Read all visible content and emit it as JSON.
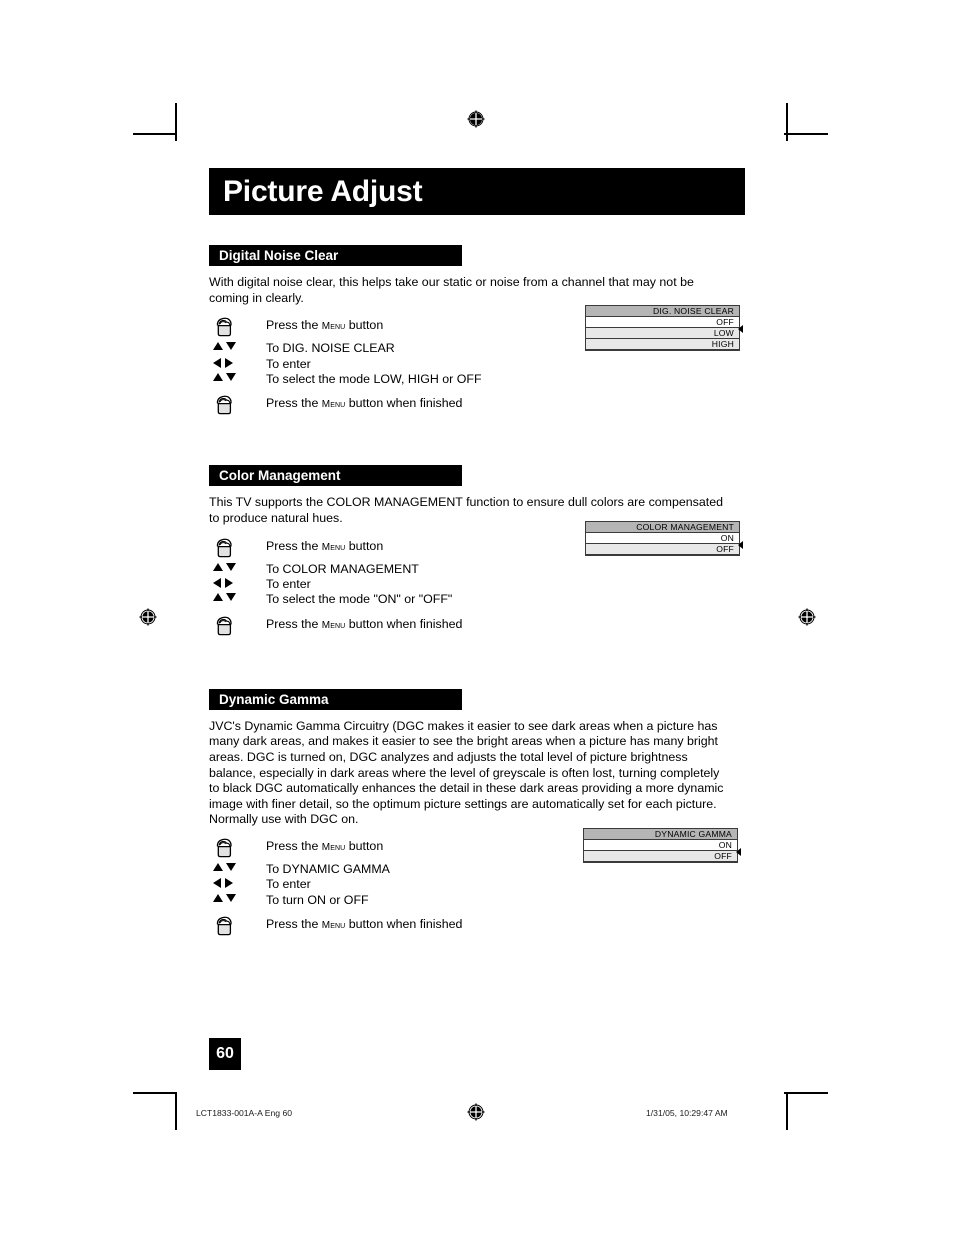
{
  "page": {
    "title": "Picture Adjust",
    "number": "60"
  },
  "sections": [
    {
      "heading": "Digital Noise Clear",
      "body": "With digital noise clear, this helps take our static or noise from a channel that may not be coming in clearly.",
      "steps": [
        {
          "key": "hand",
          "icon": "hand-press-icon",
          "text_pre": "Press the ",
          "text_smallcap": "Menu",
          "text_post": " button"
        },
        {
          "key": "updown",
          "icon": "up-down-arrows-icon",
          "text_pre": "To DIG. NOISE CLEAR",
          "text_smallcap": "",
          "text_post": ""
        },
        {
          "key": "leftright",
          "icon": "left-right-arrows-icon",
          "text_pre": "To enter",
          "text_smallcap": "",
          "text_post": ""
        },
        {
          "key": "updown",
          "icon": "up-down-arrows-icon",
          "text_pre": "To select the mode LOW,  HIGH or OFF",
          "text_smallcap": "",
          "text_post": ""
        },
        {
          "key": "hand",
          "icon": "hand-press-icon",
          "text_pre": "Press the ",
          "text_smallcap": "Menu",
          "text_post": " button when finished"
        }
      ],
      "osd": {
        "header": "DIG. NOISE CLEAR",
        "rows": [
          {
            "label": "OFF",
            "style": "white"
          },
          {
            "label": "LOW",
            "style": "grey"
          },
          {
            "label": "HIGH",
            "style": "grey"
          }
        ],
        "cursor_row": 1
      }
    },
    {
      "heading": "Color Management",
      "body": "This TV supports the COLOR MANAGEMENT function to ensure dull colors are compensated to produce natural hues.",
      "steps": [
        {
          "key": "hand",
          "icon": "hand-press-icon",
          "text_pre": "Press the ",
          "text_smallcap": "Menu",
          "text_post": " button"
        },
        {
          "key": "updown",
          "icon": "up-down-arrows-icon",
          "text_pre": "To COLOR MANAGEMENT",
          "text_smallcap": "",
          "text_post": ""
        },
        {
          "key": "leftright",
          "icon": "left-right-arrows-icon",
          "text_pre": "To enter",
          "text_smallcap": "",
          "text_post": ""
        },
        {
          "key": "updown",
          "icon": "up-down-arrows-icon",
          "text_pre": "To select the mode \"ON\" or \"OFF\"",
          "text_smallcap": "",
          "text_post": ""
        },
        {
          "key": "hand",
          "icon": "hand-press-icon",
          "text_pre": "Press the ",
          "text_smallcap": "Menu",
          "text_post": " button when finished"
        }
      ],
      "osd": {
        "header": "COLOR MANAGEMENT",
        "rows": [
          {
            "label": "ON",
            "style": "white"
          },
          {
            "label": "OFF",
            "style": "grey"
          }
        ],
        "cursor_row": 1
      }
    },
    {
      "heading": "Dynamic Gamma",
      "body": "JVC's Dynamic Gamma Circuitry (DGC makes it easier to see dark areas when a picture has many dark areas, and makes it easier to see the bright areas when a picture has many bright areas.  DGC is turned on, DGC analyzes and adjusts the total level of picture brightness balance, especially in dark areas where the level of greyscale is often lost, turning completely to black DGC automatically enhances the detail in these dark areas providing a more dynamic image with finer detail, so the optimum picture settings are automatically set for each picture. Normally use with DGC on.",
      "steps": [
        {
          "key": "hand",
          "icon": "hand-press-icon",
          "text_pre": "Press the ",
          "text_smallcap": "Menu",
          "text_post": " button"
        },
        {
          "key": "updown",
          "icon": "up-down-arrows-icon",
          "text_pre": "To DYNAMIC GAMMA",
          "text_smallcap": "",
          "text_post": ""
        },
        {
          "key": "leftright",
          "icon": "left-right-arrows-icon",
          "text_pre": "To enter",
          "text_smallcap": "",
          "text_post": ""
        },
        {
          "key": "updown",
          "icon": "up-down-arrows-icon",
          "text_pre": "To turn ON or OFF",
          "text_smallcap": "",
          "text_post": ""
        },
        {
          "key": "hand",
          "icon": "hand-press-icon",
          "text_pre": "Press the ",
          "text_smallcap": "Menu",
          "text_post": " button when finished"
        }
      ],
      "osd": {
        "header": "DYNAMIC GAMMA",
        "rows": [
          {
            "label": "ON",
            "style": "white"
          },
          {
            "label": "OFF",
            "style": "grey"
          }
        ],
        "cursor_row": 1
      }
    }
  ],
  "footer": {
    "left": "LCT1833-001A-A Eng   60",
    "right": "1/31/05, 10:29:47 AM"
  },
  "colors": {
    "bar_background": "#000000",
    "bar_text": "#ffffff",
    "osd_header": "#b5b5b5",
    "osd_row_grey": "#e8e8e8",
    "osd_row_white": "#ffffff",
    "osd_border": "#3a3a3a"
  }
}
